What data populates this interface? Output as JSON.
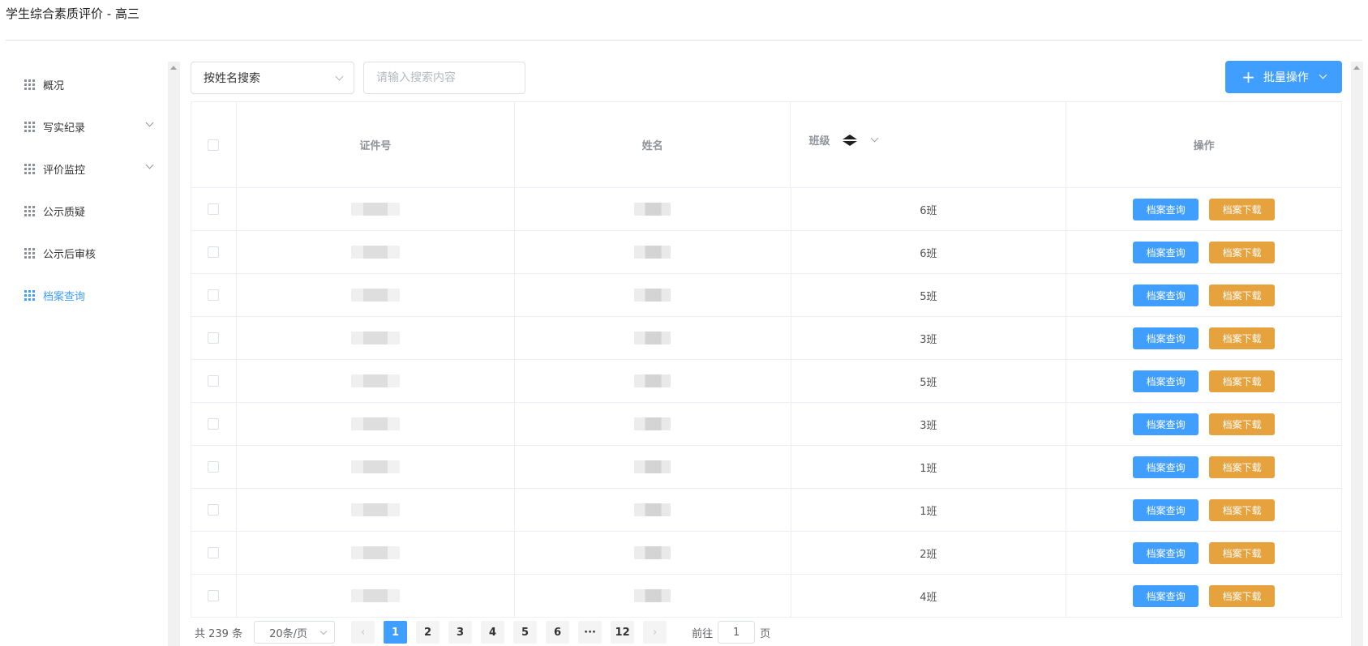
{
  "app_title": "学生综合素质评价 - 高三",
  "sidebar": {
    "items": [
      {
        "label": "概况",
        "active": false,
        "expandable": false
      },
      {
        "label": "写实纪录",
        "active": false,
        "expandable": true
      },
      {
        "label": "评价监控",
        "active": false,
        "expandable": true
      },
      {
        "label": "公示质疑",
        "active": false,
        "expandable": false
      },
      {
        "label": "公示后审核",
        "active": false,
        "expandable": false
      },
      {
        "label": "档案查询",
        "active": true,
        "expandable": false
      }
    ]
  },
  "toolbar": {
    "search_type": "按姓名搜索",
    "search_placeholder": "请输入搜索内容",
    "batch_label": "批量操作"
  },
  "table": {
    "columns": [
      "证件号",
      "姓名",
      "班级",
      "操作"
    ],
    "view_label": "档案查询",
    "download_label": "档案下载",
    "rows": [
      {
        "class": "6班"
      },
      {
        "class": "6班"
      },
      {
        "class": "5班"
      },
      {
        "class": "3班"
      },
      {
        "class": "5班"
      },
      {
        "class": "3班"
      },
      {
        "class": "1班"
      },
      {
        "class": "1班"
      },
      {
        "class": "2班"
      },
      {
        "class": "4班"
      }
    ]
  },
  "pagination": {
    "total": "共 239 条",
    "page_size": "20条/页",
    "pages": [
      "1",
      "2",
      "3",
      "4",
      "5",
      "6",
      "···",
      "12"
    ],
    "current_page": "1",
    "goto_label": "前往",
    "goto_value": "1",
    "page_suffix": "页"
  },
  "colors": {
    "primary": "#409eff",
    "warning": "#e6a23c"
  }
}
